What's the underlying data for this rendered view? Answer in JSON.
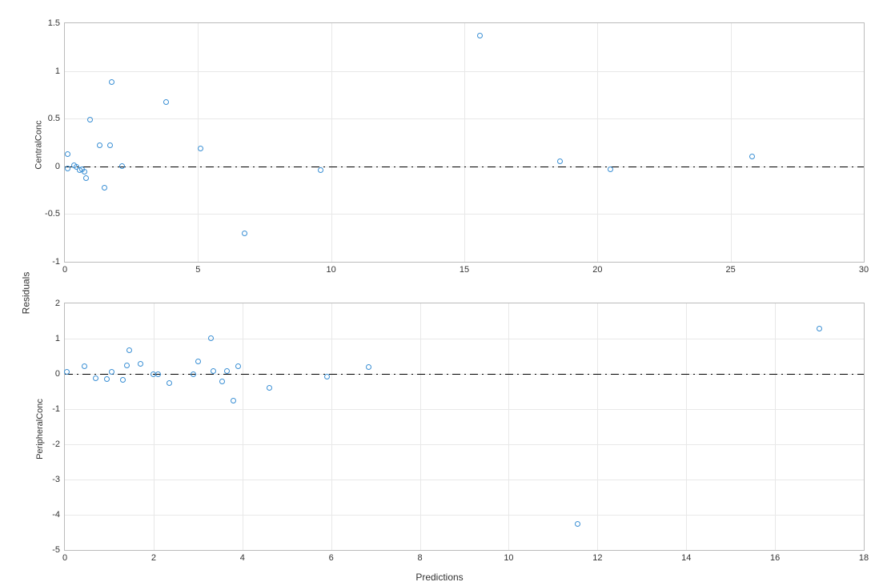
{
  "labels": {
    "global_y": "Residuals",
    "global_x": "Predictions"
  },
  "chart_data": [
    {
      "type": "scatter",
      "ylabel": "CentralConc",
      "xlim": [
        0,
        30
      ],
      "ylim": [
        -1,
        1.5
      ],
      "xticks": [
        0,
        5,
        10,
        15,
        20,
        25,
        30
      ],
      "yticks": [
        -1,
        -0.5,
        0,
        0.5,
        1,
        1.5
      ],
      "zero_y": 0,
      "points": [
        {
          "x": 0.1,
          "y": 0.13
        },
        {
          "x": 0.1,
          "y": -0.02
        },
        {
          "x": 0.35,
          "y": 0.01
        },
        {
          "x": 0.45,
          "y": -0.01
        },
        {
          "x": 0.55,
          "y": -0.04
        },
        {
          "x": 0.65,
          "y": -0.03
        },
        {
          "x": 0.75,
          "y": -0.06
        },
        {
          "x": 0.8,
          "y": -0.12
        },
        {
          "x": 0.95,
          "y": 0.49
        },
        {
          "x": 1.3,
          "y": 0.22
        },
        {
          "x": 1.5,
          "y": -0.22
        },
        {
          "x": 1.7,
          "y": 0.22
        },
        {
          "x": 1.75,
          "y": 0.88
        },
        {
          "x": 2.15,
          "y": 0.0
        },
        {
          "x": 3.8,
          "y": 0.67
        },
        {
          "x": 5.1,
          "y": 0.19
        },
        {
          "x": 6.75,
          "y": -0.7
        },
        {
          "x": 9.6,
          "y": -0.04
        },
        {
          "x": 15.6,
          "y": 1.37
        },
        {
          "x": 18.6,
          "y": 0.05
        },
        {
          "x": 20.5,
          "y": -0.03
        },
        {
          "x": 25.8,
          "y": 0.1
        }
      ]
    },
    {
      "type": "scatter",
      "ylabel": "PeripheralConc",
      "xlim": [
        0,
        18
      ],
      "ylim": [
        -5,
        2
      ],
      "xticks": [
        0,
        2,
        4,
        6,
        8,
        10,
        12,
        14,
        16,
        18
      ],
      "yticks": [
        -5,
        -4,
        -3,
        -2,
        -1,
        0,
        1,
        2
      ],
      "zero_y": 0,
      "points": [
        {
          "x": 0.05,
          "y": 0.05
        },
        {
          "x": 0.45,
          "y": 0.22
        },
        {
          "x": 0.7,
          "y": -0.12
        },
        {
          "x": 0.95,
          "y": -0.15
        },
        {
          "x": 1.05,
          "y": 0.05
        },
        {
          "x": 1.3,
          "y": -0.18
        },
        {
          "x": 1.4,
          "y": 0.25
        },
        {
          "x": 1.45,
          "y": 0.68
        },
        {
          "x": 1.7,
          "y": 0.28
        },
        {
          "x": 2.0,
          "y": 0.0
        },
        {
          "x": 2.1,
          "y": -0.02
        },
        {
          "x": 2.35,
          "y": -0.25
        },
        {
          "x": 2.9,
          "y": 0.0
        },
        {
          "x": 3.0,
          "y": 0.35
        },
        {
          "x": 3.3,
          "y": 1.02
        },
        {
          "x": 3.35,
          "y": 0.08
        },
        {
          "x": 3.55,
          "y": -0.22
        },
        {
          "x": 3.65,
          "y": 0.08
        },
        {
          "x": 3.8,
          "y": -0.75
        },
        {
          "x": 3.9,
          "y": 0.22
        },
        {
          "x": 4.6,
          "y": -0.4
        },
        {
          "x": 5.9,
          "y": -0.07
        },
        {
          "x": 6.85,
          "y": 0.2
        },
        {
          "x": 11.55,
          "y": -4.25
        },
        {
          "x": 17.0,
          "y": 1.28
        }
      ]
    }
  ]
}
